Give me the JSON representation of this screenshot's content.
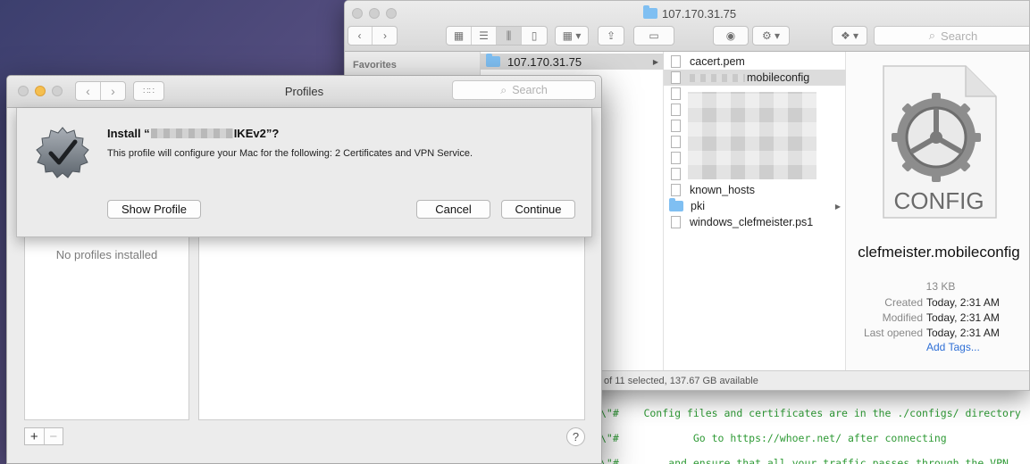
{
  "terminal": {
    "lines": [
      "\\\"#    Config files and certificates are in the ./configs/ directory",
      "\\\"#            Go to https://whoer.net/ after connecting",
      "\\\"#        and ensure that all your traffic passes through the VPN"
    ]
  },
  "finder": {
    "title": "107.170.31.75",
    "search_placeholder": "Search",
    "sidebar_heading": "Favorites",
    "column1_selected": "107.170.31.75",
    "files": [
      {
        "name": "cacert.pem",
        "kind": "doc"
      },
      {
        "name": "mobileconfig",
        "kind": "config",
        "redacted_prefix": true
      },
      {
        "name": "known_hosts",
        "kind": "doc"
      },
      {
        "name": "pki",
        "kind": "folder"
      },
      {
        "name": "windows_clefmeister.ps1",
        "kind": "doc"
      }
    ],
    "preview": {
      "icon_label": "CONFIG",
      "filename": "clefmeister.mobileconfig",
      "size": "13 KB",
      "meta": [
        {
          "key": "Created",
          "value": "Today, 2:31 AM"
        },
        {
          "key": "Modified",
          "value": "Today, 2:31 AM"
        },
        {
          "key": "Last opened",
          "value": "Today, 2:31 AM"
        }
      ],
      "add_tags": "Add Tags..."
    },
    "status": "of 11 selected, 137.67 GB available"
  },
  "profiles": {
    "title": "Profiles",
    "search_placeholder": "Search",
    "empty_text": "No profiles installed",
    "add_label": "+",
    "remove_label": "−",
    "help_label": "?",
    "sheet": {
      "title_prefix": "Install “",
      "title_suffix": "IKEv2”?",
      "description": "This profile will configure your Mac for the following: 2 Certificates and VPN Service.",
      "show_profile": "Show Profile",
      "cancel": "Cancel",
      "continue": "Continue"
    }
  }
}
